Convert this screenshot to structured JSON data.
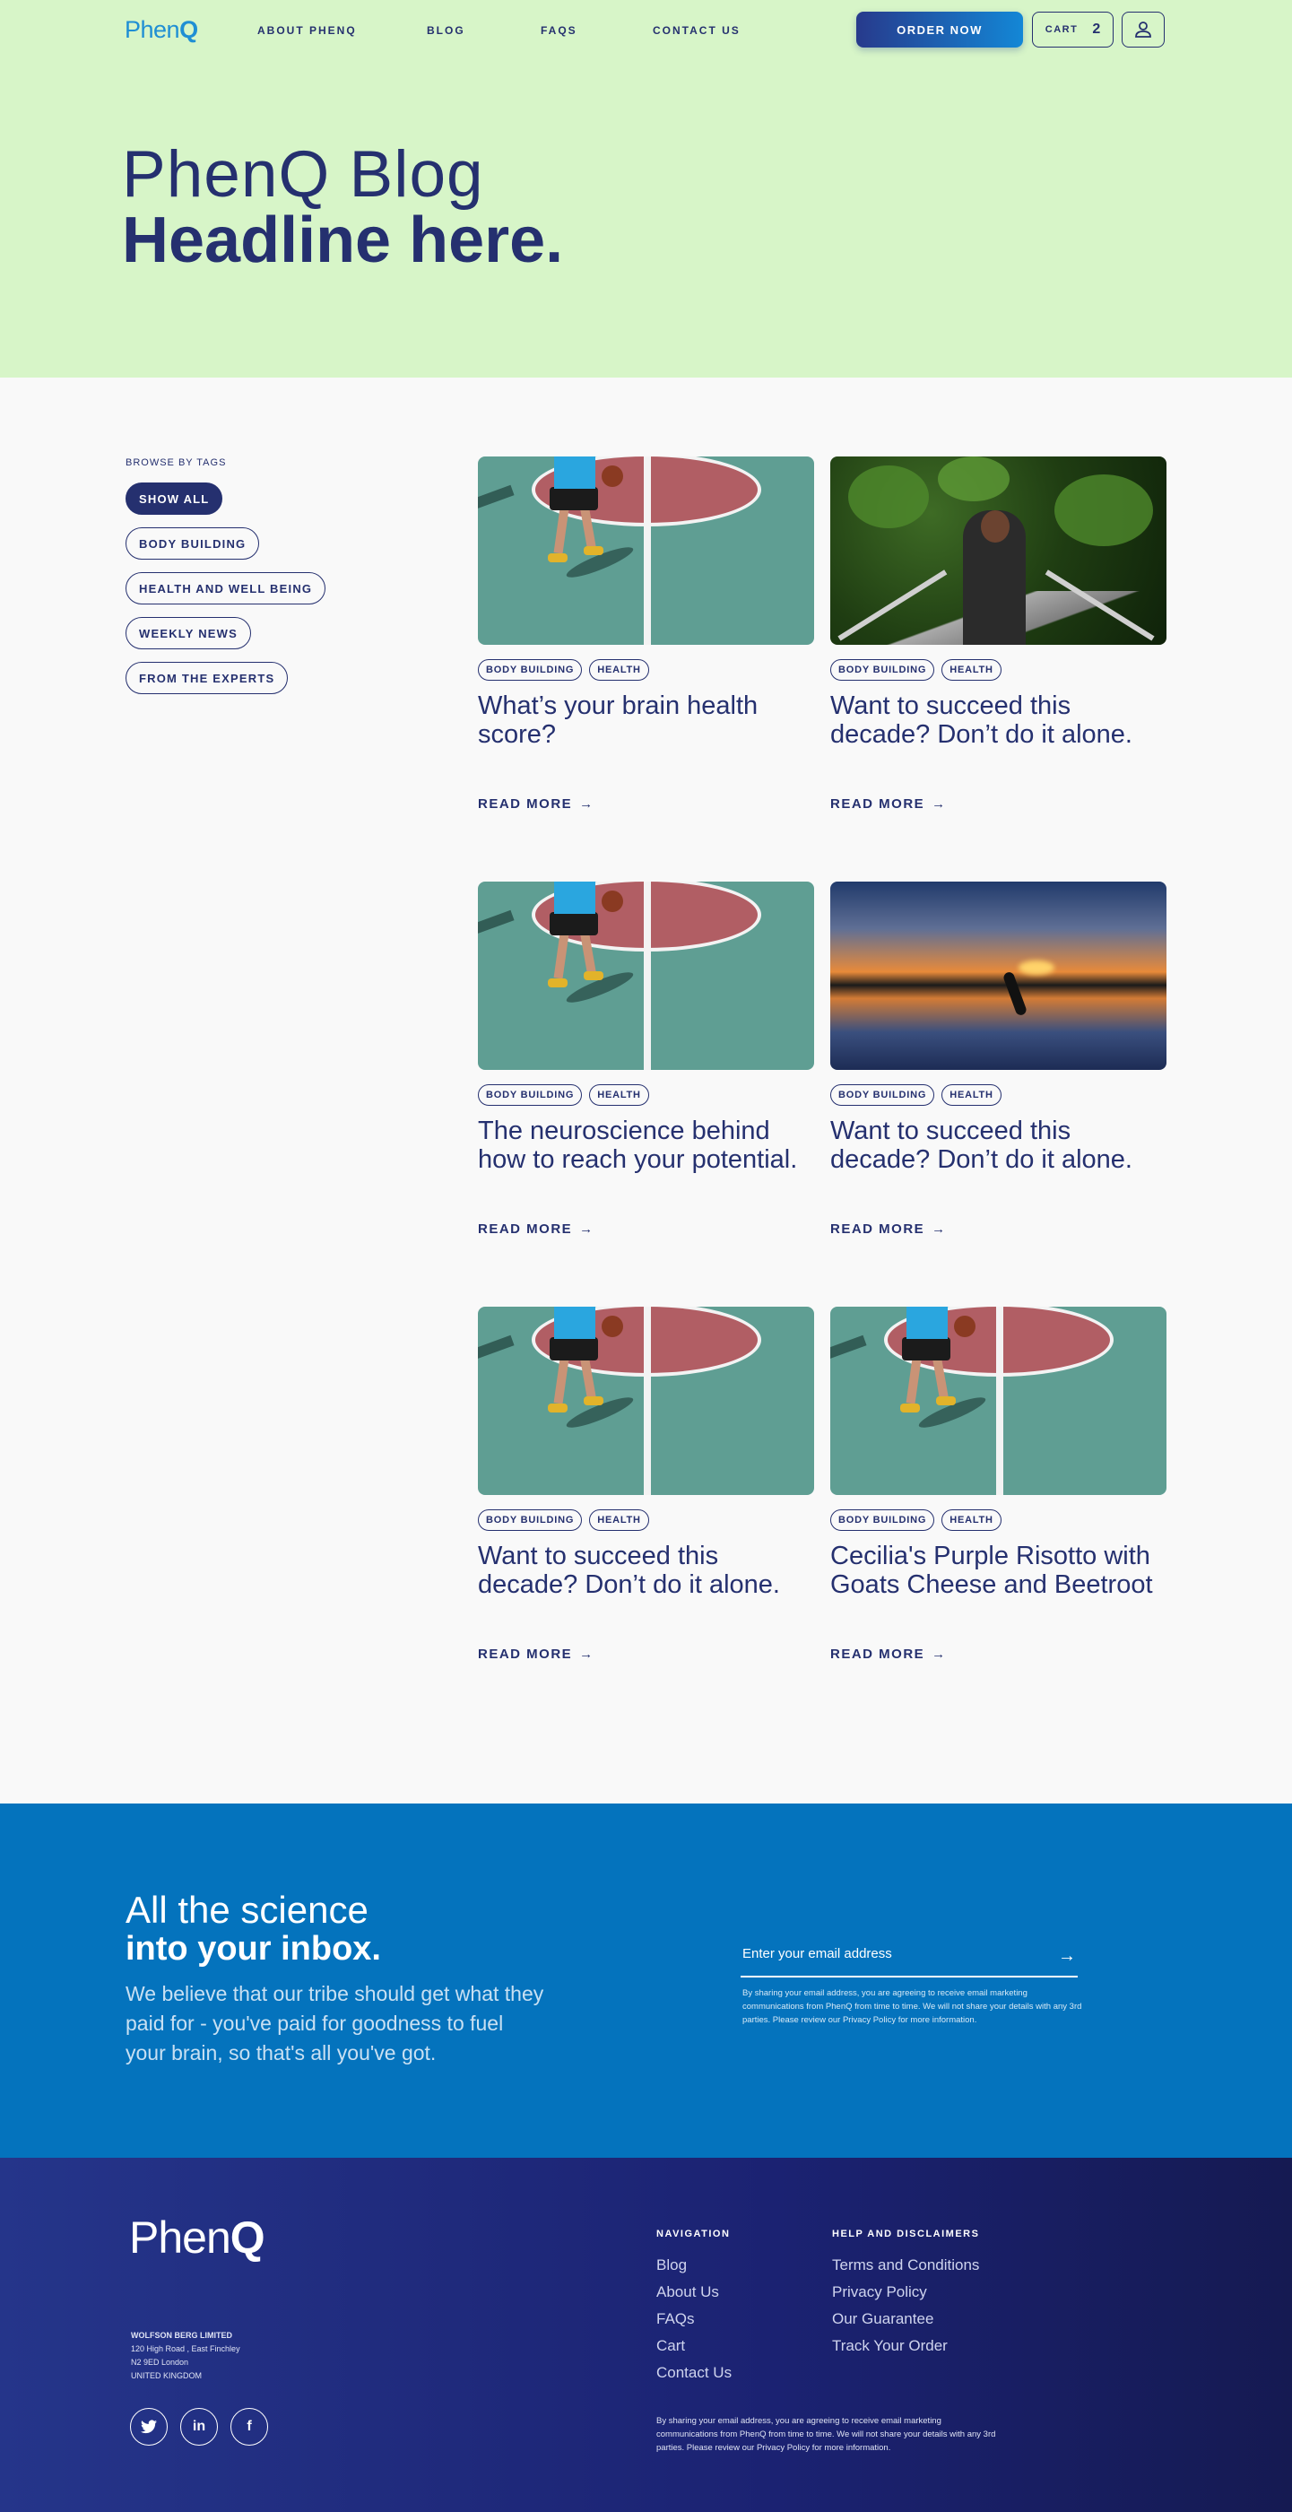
{
  "brand": {
    "logo_light": "Phen",
    "logo_bold": "Q"
  },
  "nav": {
    "links": [
      "ABOUT PHENQ",
      "BLOG",
      "FAQS",
      "CONTACT US"
    ],
    "order_button": "ORDER NOW",
    "cart_label": "CART",
    "cart_count": "2"
  },
  "hero": {
    "line1": "PhenQ Blog",
    "line2": "Headline here."
  },
  "sidebar": {
    "title": "BROWSE BY TAGS",
    "tags": [
      "SHOW ALL",
      "BODY BUILDING",
      "HEALTH AND WELL BEING",
      "WEEKLY NEWS",
      "FROM THE EXPERTS"
    ],
    "active_tag": "SHOW ALL"
  },
  "posts": [
    {
      "image": "basketball-court",
      "tags": [
        "BODY BUILDING",
        "HEALTH"
      ],
      "title": "What’s your brain health score?",
      "read_more": "READ MORE"
    },
    {
      "image": "forest-bridge-hiker",
      "tags": [
        "BODY BUILDING",
        "HEALTH"
      ],
      "title": "Want to succeed this decade? Don’t do it alone.",
      "read_more": "READ MORE"
    },
    {
      "image": "basketball-court",
      "tags": [
        "BODY BUILDING",
        "HEALTH"
      ],
      "title": "The neuroscience behind how to reach your potential.",
      "read_more": "READ MORE"
    },
    {
      "image": "sunset-lake-yoga",
      "tags": [
        "BODY BUILDING",
        "HEALTH"
      ],
      "title": "Want to succeed this decade? Don’t do it alone.",
      "read_more": "READ MORE"
    },
    {
      "image": "basketball-court",
      "tags": [
        "BODY BUILDING",
        "HEALTH"
      ],
      "title": "Want to succeed this decade? Don’t do it alone.",
      "read_more": "READ MORE"
    },
    {
      "image": "basketball-court",
      "tags": [
        "BODY BUILDING",
        "HEALTH"
      ],
      "title": "Cecilia's Purple Risotto with Goats Cheese and Beetroot",
      "read_more": "READ MORE"
    }
  ],
  "newsletter": {
    "heading_light": "All the science",
    "heading_bold": "into your inbox.",
    "body": "We believe that our tribe should get what they paid for - you've paid for goodness to fuel your brain, so that's all you've got.",
    "email_placeholder": "Enter your email address",
    "disclaimer": "By sharing your email address, you are agreeing to receive email marketing communications from PhenQ from time to time. We will not share your details with any 3rd parties. Please review our Privacy Policy for more information."
  },
  "footer": {
    "company_name": "WOLFSON BERG LIMITED",
    "address_lines": [
      "120 High Road , East Finchley",
      "N2 9ED London",
      "UNITED KINGDOM"
    ],
    "social": [
      "twitter-icon",
      "linkedin-icon",
      "facebook-icon"
    ],
    "navigation_title": "NAVIGATION",
    "navigation_links": [
      "Blog",
      "About Us",
      "FAQs",
      "Cart",
      "Contact Us"
    ],
    "help_title": "HELP AND DISCLAIMERS",
    "help_links": [
      "Terms and Conditions",
      "Privacy Policy",
      "Our Guarantee",
      "Track Your Order"
    ],
    "disclaimer": "By sharing your email address, you are agreeing to receive email marketing communications from PhenQ from time to time. We will not share your details with any 3rd parties. Please review our Privacy Policy for more information."
  },
  "colors": {
    "hero_bg": "#d7f5c8",
    "navy": "#25306f",
    "newsletter_bg": "#0473bd",
    "footer_bg": "#1b2272",
    "accent_blue": "#1f8fd4"
  }
}
